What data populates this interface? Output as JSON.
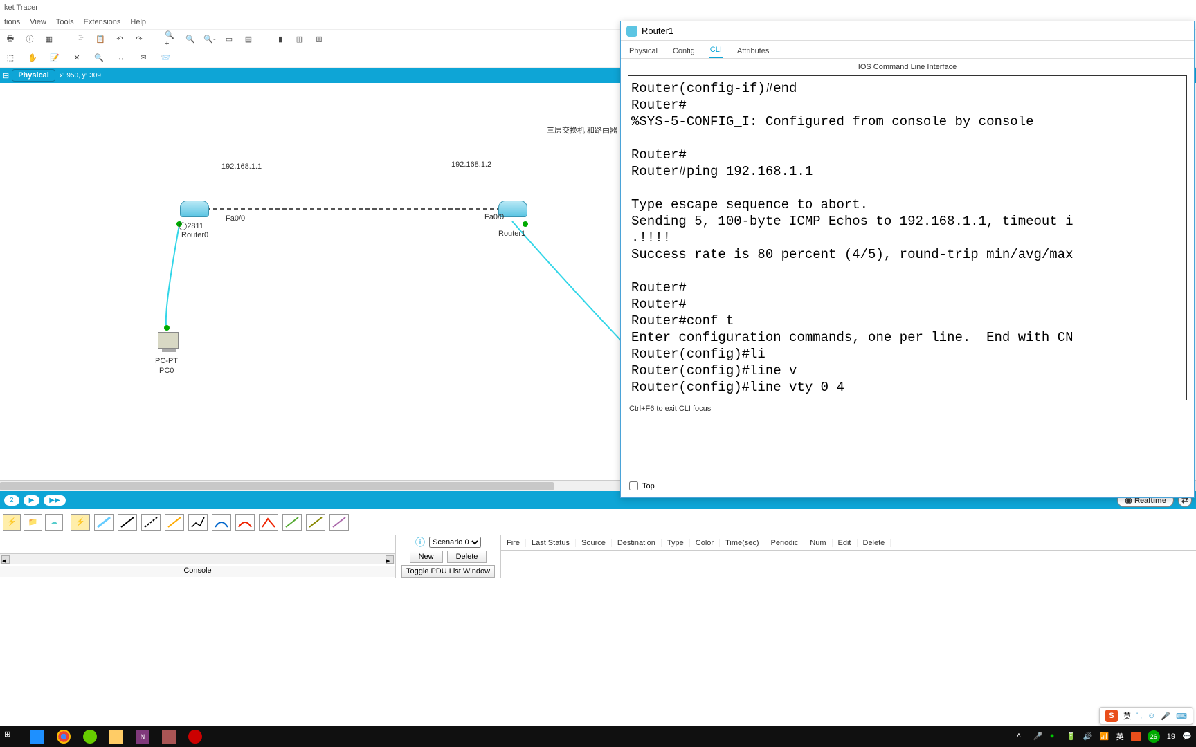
{
  "app_title": "ket Tracer",
  "menus": [
    "tions",
    "View",
    "Tools",
    "Extensions",
    "Help"
  ],
  "phys_tab": "Physical",
  "coords": "x: 950, y: 309",
  "topology_text": "三层交换机 和路由器",
  "devices": {
    "r0_ip": "192.168.1.1",
    "r0_port": "Fa0/0",
    "r0_model": "2811",
    "r0_name": "Router0",
    "r1_ip": "192.168.1.2",
    "r1_port": "Fa0/0",
    "r1_name": "Router1",
    "pc_type": "PC-PT",
    "pc_name": "PC0"
  },
  "time_label": "2",
  "realtime": "Realtime",
  "scenario_sel": "Scenario 0",
  "btn_new": "New",
  "btn_delete": "Delete",
  "btn_toggle": "Toggle PDU List Window",
  "console_label": "Console",
  "pdu_cols": [
    "Fire",
    "Last Status",
    "Source",
    "Destination",
    "Type",
    "Color",
    "Time(sec)",
    "Periodic",
    "Num",
    "Edit",
    "Delete"
  ],
  "cli": {
    "win_title": "Router1",
    "tabs": [
      "Physical",
      "Config",
      "CLI",
      "Attributes"
    ],
    "active_tab": "CLI",
    "header": "IOS Command Line Interface",
    "lines": "Router(config-if)#end\nRouter#\n%SYS-5-CONFIG_I: Configured from console by console\n\nRouter#\nRouter#ping 192.168.1.1\n\nType escape sequence to abort.\nSending 5, 100-byte ICMP Echos to 192.168.1.1, timeout i\n.!!!!\nSuccess rate is 80 percent (4/5), round-trip min/avg/max\n\nRouter#\nRouter#\nRouter#conf t\nEnter configuration commands, one per line.  End with CN\nRouter(config)#li\nRouter(config)#line v\nRouter(config)#line vty 0 4",
    "hint": "Ctrl+F6 to exit CLI focus",
    "top_chk": "Top"
  },
  "sogou": {
    "lang": "英",
    "dots": "' ,",
    "icons": [
      "☺",
      "🎤",
      "⌨"
    ]
  },
  "tray": {
    "lang": "英",
    "num": "26",
    "time": "19"
  }
}
